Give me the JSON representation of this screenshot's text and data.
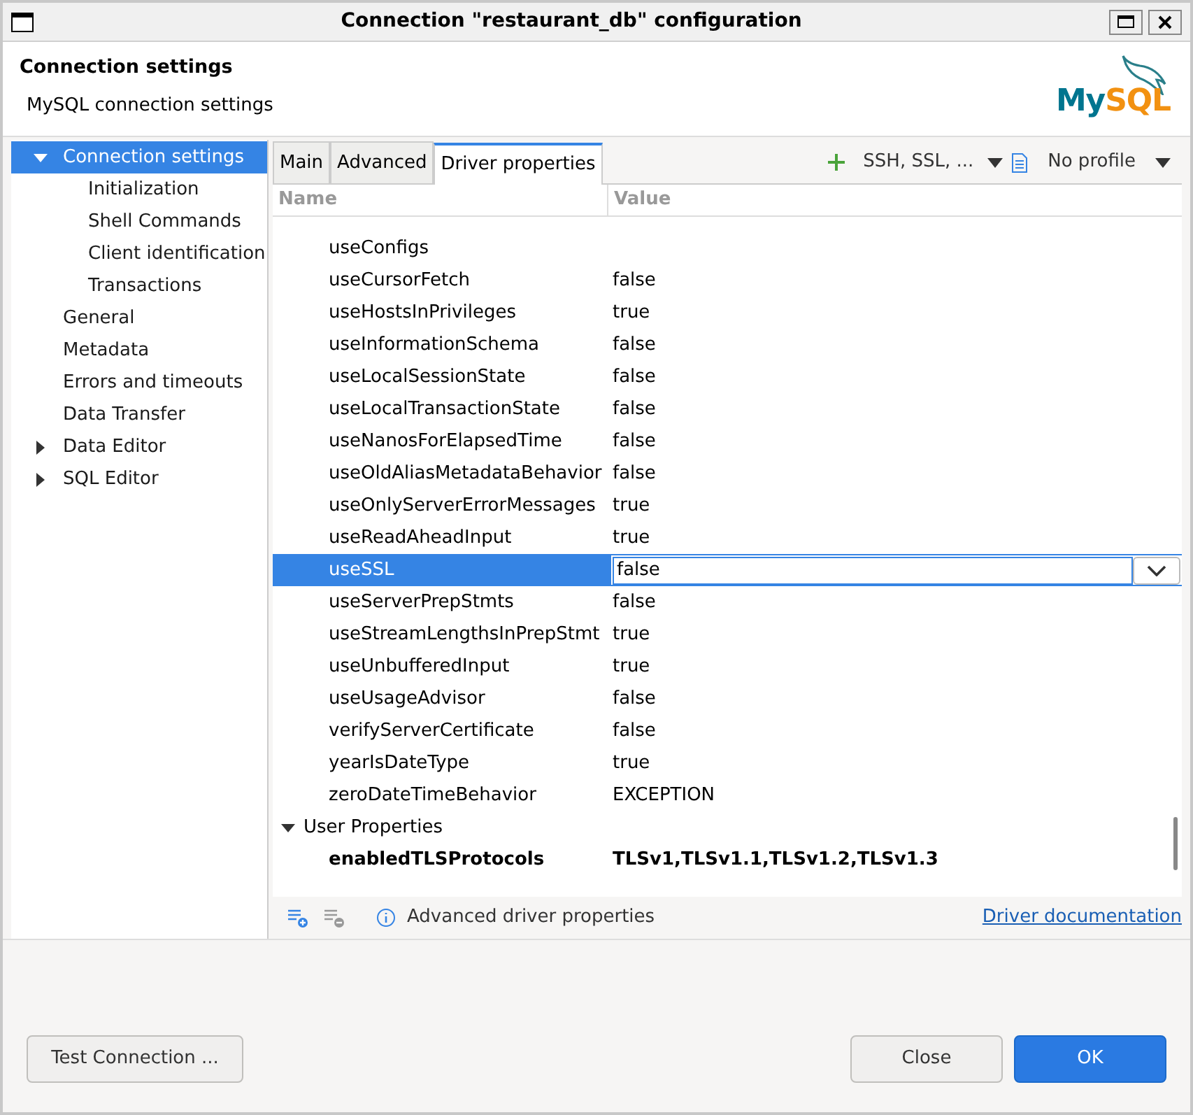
{
  "window": {
    "title": "Connection \"restaurant_db\" configuration"
  },
  "header": {
    "title": "Connection settings",
    "subtitle": "MySQL connection settings",
    "logo": [
      "My",
      "SQL"
    ]
  },
  "sidebar": {
    "items": [
      {
        "label": "Connection settings",
        "selected": true,
        "expanded": true,
        "children": [
          {
            "label": "Initialization",
            "selected": false
          },
          {
            "label": "Shell Commands",
            "selected": false
          },
          {
            "label": "Client identification",
            "selected": false
          },
          {
            "label": "Transactions",
            "selected": false
          }
        ]
      },
      {
        "label": "General",
        "selected": false
      },
      {
        "label": "Metadata",
        "selected": false
      },
      {
        "label": "Errors and timeouts",
        "selected": false
      },
      {
        "label": "Data Transfer",
        "selected": false
      },
      {
        "label": "Data Editor",
        "selected": false,
        "expanded": false
      },
      {
        "label": "SQL Editor",
        "selected": false,
        "expanded": false
      }
    ]
  },
  "tabs": [
    {
      "label": "Main",
      "selected": false
    },
    {
      "label": "Advanced",
      "selected": false
    },
    {
      "label": "Driver properties",
      "selected": true
    }
  ],
  "toolbar": {
    "network": "SSH, SSL, ...",
    "profile": "No profile"
  },
  "table": {
    "columns": [
      "Name",
      "Value"
    ],
    "rows": [
      {
        "name": "useConfigs",
        "selected": false
      },
      {
        "name": "useCursorFetch",
        "value": "false",
        "selected": false
      },
      {
        "name": "useHostsInPrivileges",
        "value": "true",
        "selected": false
      },
      {
        "name": "useInformationSchema",
        "value": "false",
        "selected": false
      },
      {
        "name": "useLocalSessionState",
        "value": "false",
        "selected": false
      },
      {
        "name": "useLocalTransactionState",
        "value": "false",
        "selected": false
      },
      {
        "name": "useNanosForElapsedTime",
        "value": "false",
        "selected": false
      },
      {
        "name": "useOldAliasMetadataBehavior",
        "value": "false",
        "selected": false
      },
      {
        "name": "useOnlyServerErrorMessages",
        "value": "true",
        "selected": false
      },
      {
        "name": "useReadAheadInput",
        "value": "true",
        "selected": false
      },
      {
        "name": "useSSL",
        "value": "false",
        "selected": true
      },
      {
        "name": "useServerPrepStmts",
        "value": "false",
        "selected": false
      },
      {
        "name": "useStreamLengthsInPrepStmt",
        "value": "true",
        "selected": false
      },
      {
        "name": "useUnbufferedInput",
        "value": "true",
        "selected": false
      },
      {
        "name": "useUsageAdvisor",
        "value": "false",
        "selected": false
      },
      {
        "name": "verifyServerCertificate",
        "value": "false",
        "selected": false
      },
      {
        "name": "yearIsDateType",
        "value": "true",
        "selected": false
      },
      {
        "name": "zeroDateTimeBehavior",
        "value": "EXCEPTION",
        "selected": false
      }
    ],
    "group": {
      "label": "User Properties",
      "expanded": true,
      "rows": [
        {
          "name": "enabledTLSProtocols",
          "value": "TLSv1,TLSv1.1,TLSv1.2,TLSv1.3"
        }
      ]
    }
  },
  "footer": {
    "info": "Advanced driver properties",
    "link": "Driver documentation"
  },
  "buttons": {
    "test": "Test Connection ...",
    "close": "Close",
    "ok": "OK"
  }
}
